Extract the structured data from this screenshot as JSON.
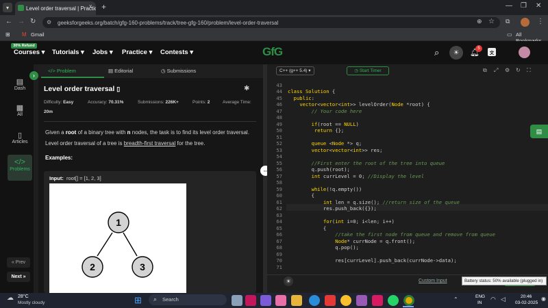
{
  "browser": {
    "tab_title": "Level order traversal | Practice |",
    "tab_close": "x",
    "new_tab": "+",
    "url": "geeksforgeeks.org/batch/gfg-160-problems/track/tree-gfg-160/problem/level-order-traversal",
    "bookmark_gmail": "Gmail",
    "all_bookmarks": "All Bookmarks"
  },
  "header": {
    "refund_badge": "30% Refund",
    "nav": [
      "Courses",
      "Tutorials",
      "Jobs",
      "Practice",
      "Contests"
    ],
    "logo": "GfG",
    "notification_count": "5"
  },
  "rail": {
    "items": [
      "Dash",
      "All",
      "Articles",
      "Problems"
    ],
    "prev": "« Prev",
    "next": "Next »"
  },
  "problem": {
    "tabs": [
      "Problem",
      "Editorial",
      "Submissions"
    ],
    "title": "Level order traversal",
    "difficulty_label": "Difficulty:",
    "difficulty": "Easy",
    "accuracy_label": "Accuracy:",
    "accuracy": "70.31%",
    "submissions_label": "Submissions:",
    "submissions": "226K+",
    "points_label": "Points:",
    "points": "2",
    "avg_time_label": "Average Time:",
    "avg_time": "20m",
    "desc_part1": "Given a ",
    "desc_root": "root",
    "desc_part2": " of a binary tree with ",
    "desc_n": "n",
    "desc_part3": " nodes, the task is to find its level order traversal. Level order traversal of a tree is ",
    "desc_link": "breadth-first traversal",
    "desc_part4": " for the tree.",
    "examples_heading": "Examples:",
    "input_label": "Input:",
    "input_value": "root[] = [1, 2, 3]",
    "tree_nodes": [
      "1",
      "2",
      "3"
    ]
  },
  "editor": {
    "language": "C++ (g++ 5.4)",
    "start_timer": "Start Timer",
    "custom_input": "Custom Input",
    "line_numbers": [
      "43",
      "44",
      "45",
      "46",
      "47",
      "48",
      "49",
      "50",
      "51",
      "52",
      "53",
      "54",
      "55",
      "56",
      "57",
      "58",
      "59",
      "60",
      "61",
      "62",
      "63",
      "64",
      "65",
      "66",
      "67",
      "68",
      "69",
      "70",
      "71"
    ]
  },
  "taskbar": {
    "weather_temp": "28°C",
    "weather_desc": "Mostly cloudy",
    "search": "Search",
    "lang": "ENG",
    "region": "IN",
    "time": "20:46",
    "date": "03-02-2025",
    "battery_tooltip": "Battery status: 50% available (plugged in)"
  },
  "colors": {
    "brand_green": "#2f8d46",
    "accent_green": "#2fb65c",
    "notification_red": "#e53935"
  }
}
